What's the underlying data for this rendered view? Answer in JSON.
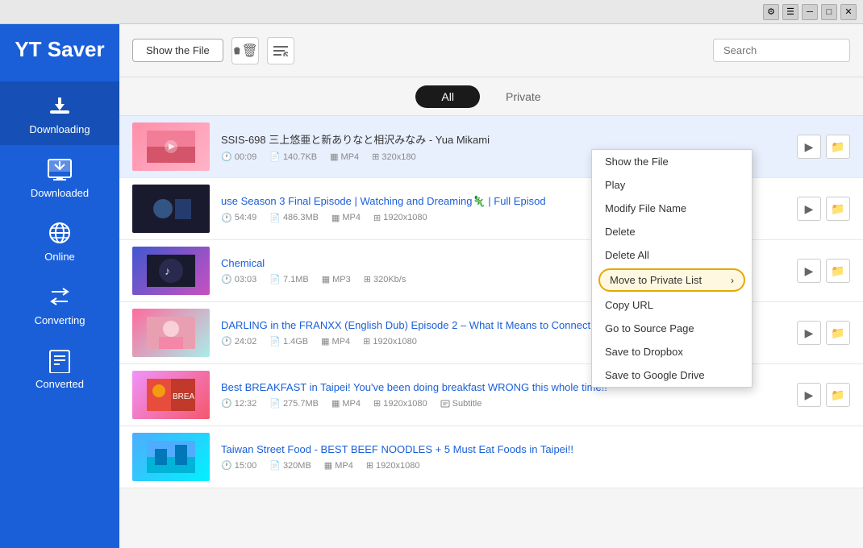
{
  "app": {
    "title": "YT Saver"
  },
  "titlebar": {
    "buttons": [
      "settings",
      "menu",
      "minimize",
      "maximize",
      "close"
    ]
  },
  "toolbar": {
    "show_file_label": "Show the File",
    "search_placeholder": "Search"
  },
  "tabs": {
    "all_label": "All",
    "private_label": "Private"
  },
  "sidebar": {
    "items": [
      {
        "id": "downloading",
        "label": "Downloading",
        "icon": "⬇"
      },
      {
        "id": "downloaded",
        "label": "Downloaded",
        "icon": "🎬"
      },
      {
        "id": "online",
        "label": "Online",
        "icon": "🌐"
      },
      {
        "id": "converting",
        "label": "Converting",
        "icon": "↗"
      },
      {
        "id": "converted",
        "label": "Converted",
        "icon": "📋"
      }
    ]
  },
  "files": [
    {
      "id": 1,
      "title": "SSIS-698 三上悠亜と新ありなと相沢みなみ - Yua Mikami",
      "title_color": "normal",
      "duration": "00:09",
      "size": "140.7KB",
      "format": "MP4",
      "resolution": "320x180",
      "thumb_class": "thumb-pink",
      "has_subtitle": false
    },
    {
      "id": 2,
      "title": "use Season 3 Final Episode | Watching and Dreaming🦎 | Full Episod",
      "title_color": "blue",
      "duration": "54:49",
      "size": "486.3MB",
      "format": "MP4",
      "resolution": "1920x1080",
      "thumb_class": "thumb-dark",
      "has_subtitle": false
    },
    {
      "id": 3,
      "title": "Chemical",
      "title_color": "blue",
      "duration": "03:03",
      "size": "7.1MB",
      "format": "MP3",
      "resolution": "320Kb/s",
      "thumb_class": "thumb-blue",
      "has_subtitle": false
    },
    {
      "id": 4,
      "title": "DARLING in the FRANXX (English Dub) Episode 2 – What It Means to Connect",
      "title_color": "blue",
      "duration": "24:02",
      "size": "1.4GB",
      "format": "MP4",
      "resolution": "1920x1080",
      "thumb_class": "thumb-anime",
      "has_subtitle": false
    },
    {
      "id": 5,
      "title": "Best BREAKFAST in Taipei! You've been doing breakfast WRONG this whole time!!",
      "title_color": "blue",
      "duration": "12:32",
      "size": "275.7MB",
      "format": "MP4",
      "resolution": "1920x1080",
      "thumb_class": "thumb-food",
      "has_subtitle": true,
      "subtitle_label": "Subtitle"
    },
    {
      "id": 6,
      "title": "Taiwan Street Food - BEST BEEF NOODLES + 5 Must Eat Foods in Taipei!!",
      "title_color": "blue",
      "duration": "15:00",
      "size": "320MB",
      "format": "MP4",
      "resolution": "1920x1080",
      "thumb_class": "thumb-street",
      "has_subtitle": false
    }
  ],
  "context_menu": {
    "items": [
      {
        "id": "show-file",
        "label": "Show the File",
        "highlighted": false
      },
      {
        "id": "play",
        "label": "Play",
        "highlighted": false
      },
      {
        "id": "modify-name",
        "label": "Modify File Name",
        "highlighted": false
      },
      {
        "id": "delete",
        "label": "Delete",
        "highlighted": false
      },
      {
        "id": "delete-all",
        "label": "Delete All",
        "highlighted": false
      },
      {
        "id": "move-private",
        "label": "Move to Private List",
        "highlighted": true
      },
      {
        "id": "copy-url",
        "label": "Copy URL",
        "highlighted": false
      },
      {
        "id": "goto-source",
        "label": "Go to Source Page",
        "highlighted": false
      },
      {
        "id": "save-dropbox",
        "label": "Save to Dropbox",
        "highlighted": false
      },
      {
        "id": "save-gdrive",
        "label": "Save to Google Drive",
        "highlighted": false
      }
    ]
  }
}
